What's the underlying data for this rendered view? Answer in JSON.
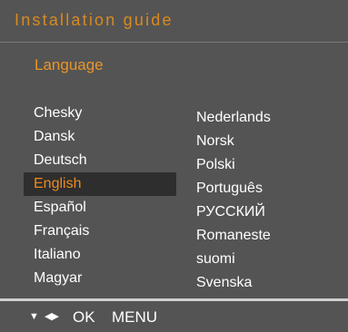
{
  "title": "Installation guide",
  "section": "Language",
  "languages_left": [
    "Chesky",
    "Dansk",
    "Deutsch",
    "English",
    "Español",
    "Français",
    "Italiano",
    "Magyar"
  ],
  "languages_right": [
    "Nederlands",
    "Norsk",
    "Polski",
    "Português",
    "РУССКИЙ",
    "Romaneste",
    "suomi",
    "Svenska"
  ],
  "selected": "English",
  "footer": {
    "down_icon": "down-arrow-icon",
    "left_right_icon": "left-right-arrows-icon",
    "ok_label": "OK",
    "menu_label": "MENU"
  },
  "colors": {
    "accent": "#e8952a",
    "background": "#545454",
    "highlight": "#2e2e2e"
  }
}
